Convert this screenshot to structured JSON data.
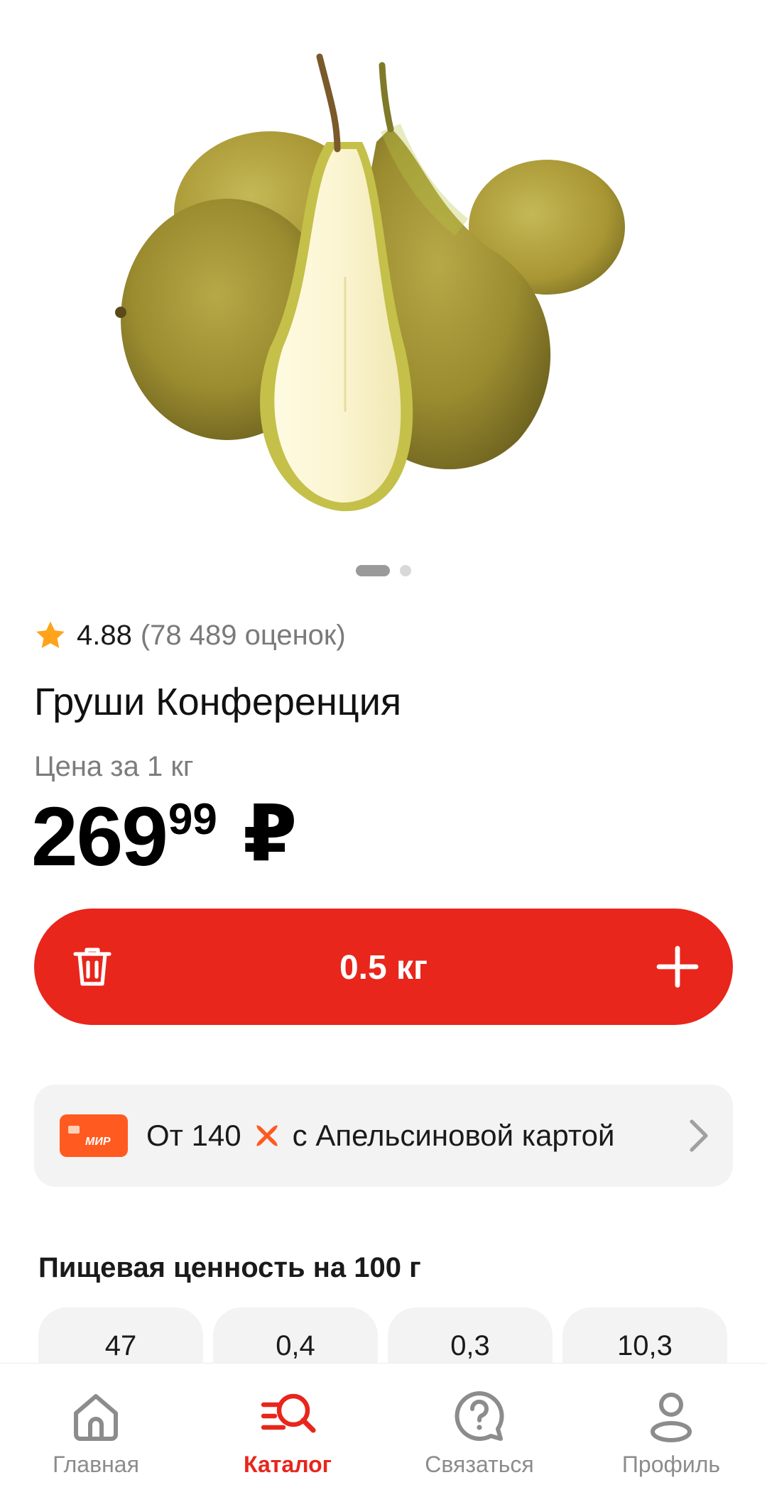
{
  "product": {
    "image_alt": "pears",
    "rating_value": "4.88",
    "rating_count": "(78 489 оценок)",
    "title": "Груши Конференция",
    "price_label": "Цена за 1 кг",
    "price_main": "269",
    "price_cents": "99",
    "currency": "₽"
  },
  "pager": {
    "total": 2,
    "active": 1
  },
  "cart": {
    "quantity": "0.5 кг"
  },
  "promo": {
    "prefix": "От 140",
    "suffix": "с Апельсиновой картой",
    "card_label": "МИР"
  },
  "nutrition": {
    "title": "Пищевая ценность на 100 г",
    "values": [
      "47",
      "0,4",
      "0,3",
      "10,3"
    ]
  },
  "tabs": [
    {
      "label": "Главная",
      "icon": "home-icon",
      "active": false
    },
    {
      "label": "Каталог",
      "icon": "catalog-search-icon",
      "active": true
    },
    {
      "label": "Связаться",
      "icon": "chat-question-icon",
      "active": false
    },
    {
      "label": "Профиль",
      "icon": "profile-icon",
      "active": false
    }
  ],
  "colors": {
    "accent": "#e8261c",
    "star": "#ffa31a",
    "promo_card": "#ff5a1f"
  }
}
